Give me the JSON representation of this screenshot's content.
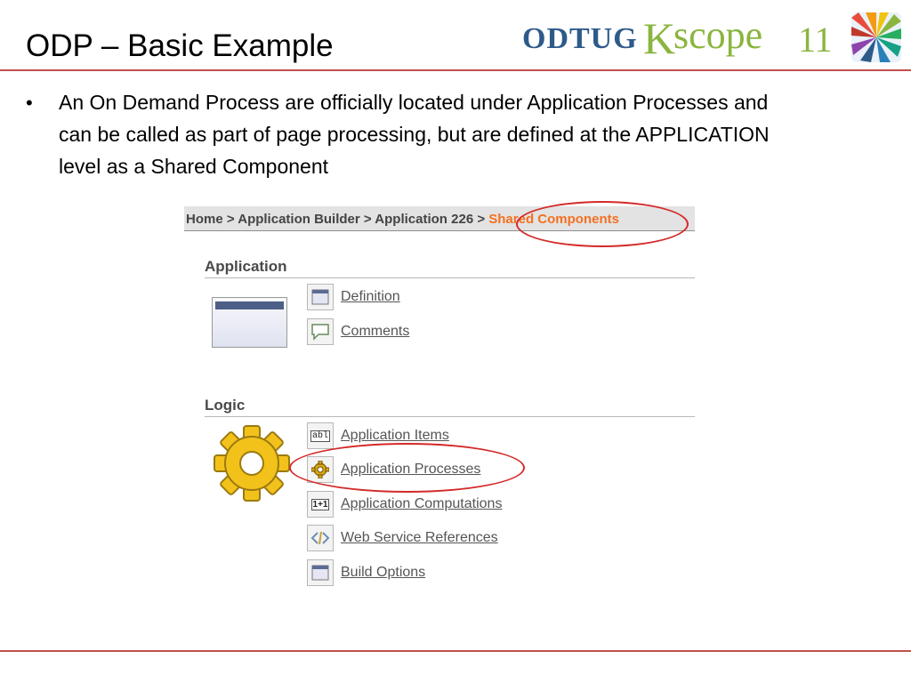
{
  "slide": {
    "title": "ODP – Basic Example",
    "bullet": "An On Demand Process are officially located under Application Processes and can be called as part of page processing, but are defined at the APPLICATION level as a Shared Component"
  },
  "logo": {
    "part1": "ODTUG",
    "part2": "K",
    "part3": "scope",
    "part4": "11"
  },
  "screenshot": {
    "breadcrumb": {
      "items": [
        "Home",
        "Application Builder",
        "Application 226"
      ],
      "separator": " > ",
      "current": "Shared Components"
    },
    "sections": [
      {
        "title": "Application",
        "links": [
          {
            "label": "Definition",
            "icon": "window-icon"
          },
          {
            "label": "Comments",
            "icon": "speech-bubble-icon"
          }
        ]
      },
      {
        "title": "Logic",
        "links": [
          {
            "label": "Application Items",
            "icon": "text-field-icon",
            "icon_text": "abl"
          },
          {
            "label": "Application Processes",
            "icon": "gear-icon"
          },
          {
            "label": "Application Computations",
            "icon": "computation-icon",
            "icon_text": "1+1"
          },
          {
            "label": "Web Service References",
            "icon": "code-brackets-icon"
          },
          {
            "label": "Build Options",
            "icon": "window-icon"
          }
        ]
      }
    ]
  },
  "colors": {
    "rule": "#c0504d",
    "breadcrumb_current": "#f37021",
    "callout": "#d42a2a",
    "logo_blue": "#2e5a8a",
    "logo_green": "#8ab53f"
  }
}
